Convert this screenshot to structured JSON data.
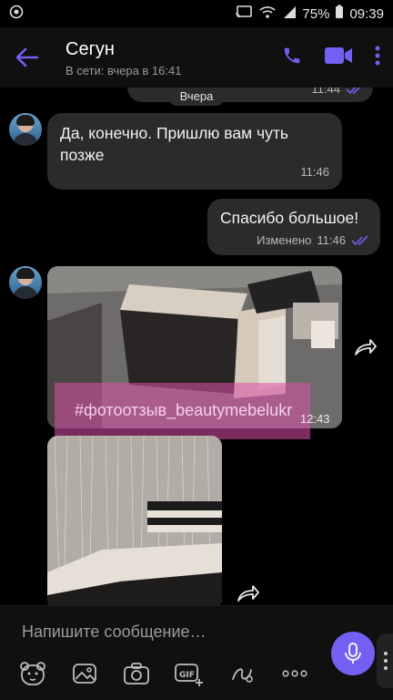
{
  "status_bar": {
    "battery": "75%",
    "time": "09:39"
  },
  "header": {
    "name": "Сегун",
    "status": "В сети: вчера в 16:41"
  },
  "chat": {
    "date_divider": "Вчера",
    "top_partial_time": "11:44",
    "messages": [
      {
        "text": "Да, конечно. Пришлю вам чуть позже",
        "time": "11:46"
      },
      {
        "text": "Спасибо большое!",
        "edited": "Изменено",
        "time": "11:46"
      }
    ],
    "photo_caption": "#фотоотзыв_beautymebelukr",
    "photo_time": "12:43"
  },
  "input": {
    "placeholder": "Напишите сообщение…"
  },
  "colors": {
    "accent": "#7360f2",
    "bubble": "#2b2b2b",
    "background": "#000000"
  }
}
